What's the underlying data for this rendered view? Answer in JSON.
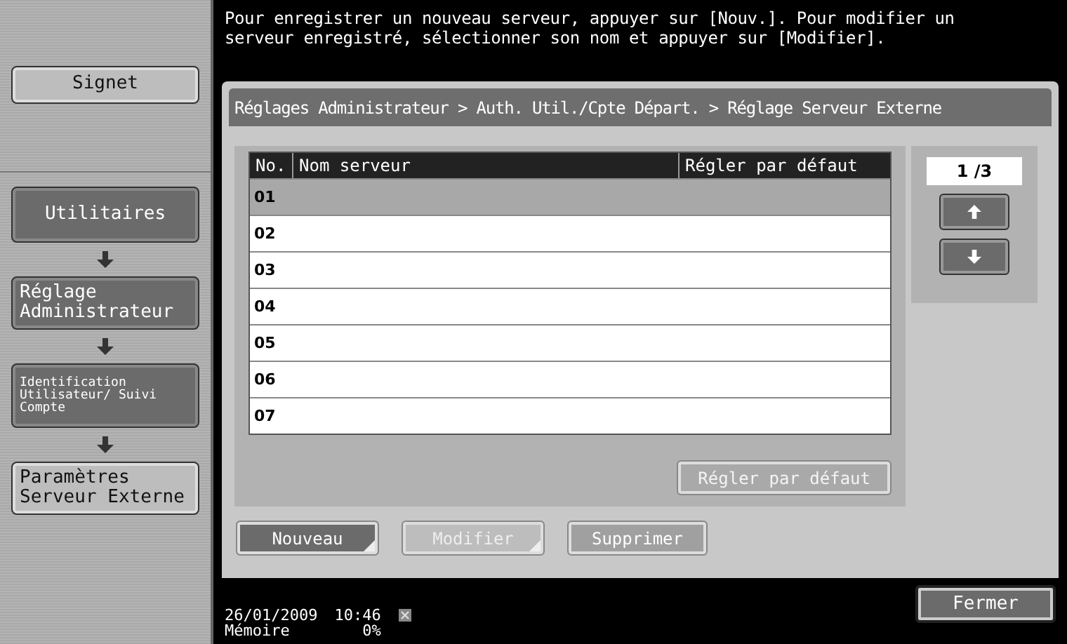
{
  "message": "Pour enregistrer un nouveau serveur, appuyer sur [Nouv.]. Pour modifier un serveur enregistré, sélectionner son nom et appuyer sur [Modifier].",
  "bookmark_button": "Signet",
  "breadcrumb_steps": [
    {
      "label": "Utilitaires",
      "current": false,
      "small": false
    },
    {
      "label": "Réglage Administrateur",
      "current": false,
      "small": false
    },
    {
      "label": "Identification Utilisateur/ Suivi Compte",
      "current": false,
      "small": true
    },
    {
      "label": "Paramètres Serveur Externe",
      "current": true,
      "small": false
    }
  ],
  "panel_title": "Réglages Administrateur > Auth. Util./Cpte Départ. > Réglage Serveur Externe",
  "table": {
    "columns": [
      "No.",
      "Nom serveur",
      "Régler par défaut"
    ],
    "rows": [
      {
        "no": "01",
        "selected": true
      },
      {
        "no": "02",
        "selected": false
      },
      {
        "no": "03",
        "selected": false
      },
      {
        "no": "04",
        "selected": false
      },
      {
        "no": "05",
        "selected": false
      },
      {
        "no": "06",
        "selected": false
      },
      {
        "no": "07",
        "selected": false
      }
    ]
  },
  "pager": {
    "page": "1 /3"
  },
  "default_button": {
    "label": "Régler par défaut",
    "disabled": true
  },
  "action_buttons": [
    {
      "label": "Nouveau",
      "disabled": false,
      "submenu": true
    },
    {
      "label": "Modifier",
      "disabled": true,
      "submenu": true
    },
    {
      "label": "Supprimer",
      "disabled": true,
      "submenu": false
    }
  ],
  "status": {
    "date": "26/01/2009",
    "time": "10:46",
    "memory_label": "Mémoire",
    "memory_value": "0%"
  },
  "close_button": "Fermer"
}
